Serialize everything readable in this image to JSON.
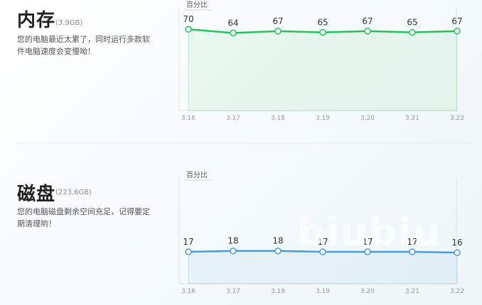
{
  "memory": {
    "title": "内存",
    "size": "(3.9GB)",
    "desc": "您的电脑最近太累了，同时运行多款软件电脑速度会变慢呦！",
    "color": "#22c45a",
    "chart_data": {
      "type": "line",
      "ylabel": "百分比",
      "categories": [
        "3.16",
        "3.17",
        "3.18",
        "3.19",
        "3.20",
        "3.21",
        "3.22"
      ],
      "values": [
        70,
        64,
        67,
        65,
        67,
        65,
        67
      ],
      "ylim": [
        0,
        100
      ]
    }
  },
  "disk": {
    "title": "磁盘",
    "size": "(223.6GB)",
    "desc": "您的电脑磁盘剩余空间充足，记得要定期清理哟！",
    "color": "#4a9be0",
    "chart_data": {
      "type": "line",
      "ylabel": "百分比",
      "categories": [
        "3.16",
        "3.17",
        "3.18",
        "3.19",
        "3.20",
        "3.21",
        "3.22"
      ],
      "values": [
        17,
        18,
        18,
        17,
        17,
        17,
        16
      ],
      "ylim": [
        0,
        100
      ]
    }
  },
  "watermark": "biubiu"
}
